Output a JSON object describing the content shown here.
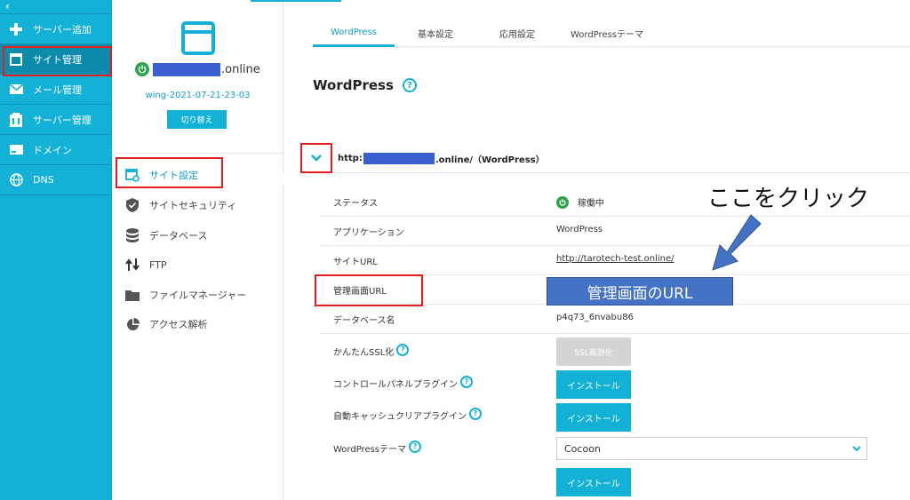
{
  "nav": {
    "collapse_glyph": "‹",
    "items": [
      {
        "label": "サーバー追加",
        "icon": "plus-icon"
      },
      {
        "label": "サイト管理",
        "icon": "window-icon",
        "active": true
      },
      {
        "label": "メール管理",
        "icon": "mail-icon"
      },
      {
        "label": "サーバー管理",
        "icon": "server-icon"
      },
      {
        "label": "ドメイン",
        "icon": "domain-icon"
      },
      {
        "label": "DNS",
        "icon": "globe-icon"
      }
    ]
  },
  "site": {
    "domain_suffix": ".online",
    "server_name": "wing-2021-07-21-23-03",
    "switch_label": "切り替え",
    "menu": [
      {
        "label": "サイト設定",
        "icon": "site-settings-icon",
        "active": true
      },
      {
        "label": "サイトセキュリティ",
        "icon": "shield-icon"
      },
      {
        "label": "データベース",
        "icon": "database-icon"
      },
      {
        "label": "FTP",
        "icon": "ftp-icon"
      },
      {
        "label": "ファイルマネージャー",
        "icon": "folder-icon"
      },
      {
        "label": "アクセス解析",
        "icon": "pie-chart-icon"
      }
    ]
  },
  "main": {
    "tabs": [
      {
        "label": "WordPress",
        "active": true
      },
      {
        "label": "基本設定"
      },
      {
        "label": "応用設定"
      },
      {
        "label": "WordPressテーマ"
      }
    ],
    "title": "WordPress",
    "help_glyph": "?",
    "accordion": {
      "url_prefix": "http:",
      "url_suffix": ".online/（WordPress）"
    },
    "rows": {
      "status": {
        "label": "ステータス",
        "value": "稼働中"
      },
      "application": {
        "label": "アプリケーション",
        "value": "WordPress"
      },
      "site_url": {
        "label": "サイトURL",
        "value": "http://tarotech-test.online/"
      },
      "admin_url": {
        "label": "管理画面URL"
      },
      "db_name": {
        "label": "データベース名",
        "value": "p4q73_6nvabu86"
      },
      "ssl": {
        "label": "かんたんSSL化",
        "button": "SSL有効化"
      },
      "cp_plugin": {
        "label": "コントロールパネルプラグイン",
        "button": "インストール"
      },
      "cache_plugin": {
        "label": "自動キャッシュクリアプラグイン",
        "button": "インストール"
      },
      "theme": {
        "label": "WordPressテーマ",
        "selected": "Cocoon",
        "button": "インストール"
      }
    }
  },
  "annotations": {
    "callout": "ここをクリック",
    "admin_box": "管理画面のURL",
    "highlight_color": "#e02020",
    "arrow_color": "#4472c4"
  },
  "colors": {
    "accent": "#13b1d6",
    "nav_active": "#0c8bab",
    "status_green": "#2ea44f",
    "mask_blue": "#3a5fd0"
  }
}
